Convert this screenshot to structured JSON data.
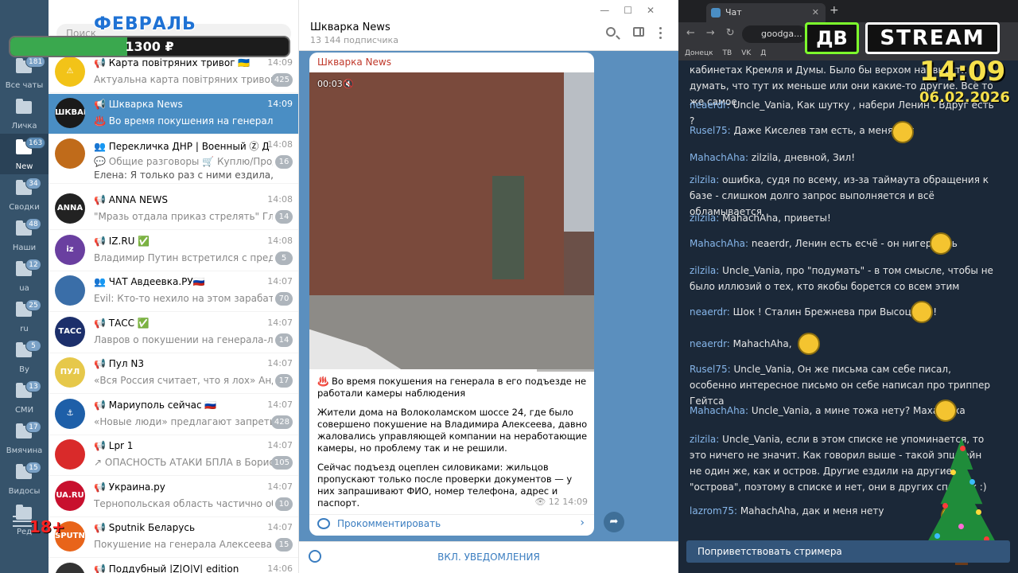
{
  "telegram": {
    "folders": [
      {
        "label": "Все чаты",
        "badge": "181",
        "active": false
      },
      {
        "label": "Личка",
        "badge": "",
        "active": false
      },
      {
        "label": "New",
        "badge": "163",
        "active": true
      },
      {
        "label": "Сводки",
        "badge": "34",
        "active": false
      },
      {
        "label": "Наши",
        "badge": "48",
        "active": false
      },
      {
        "label": "ua",
        "badge": "12",
        "active": false
      },
      {
        "label": "ru",
        "badge": "25",
        "active": false
      },
      {
        "label": "By",
        "badge": "5",
        "active": false
      },
      {
        "label": "СМИ",
        "badge": "13",
        "active": false
      },
      {
        "label": "Вмячина",
        "badge": "17",
        "active": false
      },
      {
        "label": "Видосы",
        "badge": "15",
        "active": false
      },
      {
        "label": "Ред",
        "badge": "",
        "active": false
      }
    ],
    "age_label": "18+",
    "search_placeholder": "Поиск",
    "chats": [
      {
        "name": "📢 Карта повітряних тривог 🇺🇦",
        "time": "14:09",
        "preview": "Актуальна карта повітряних тривог ...",
        "badge": "425",
        "avatar_color": "#f2c318",
        "avatar_text": "⚠",
        "active": false
      },
      {
        "name": "📢 Шкварка News",
        "time": "14:09",
        "preview": "♨️ Во время покушения на генерала в его...",
        "badge": "",
        "avatar_color": "#1a1a1a",
        "avatar_text": "ШКВАРКА",
        "active": true
      },
      {
        "name": "👥 Перекличка ДНР | Военный Ⓩ Дон...",
        "time": "14:08",
        "preview": "💬 Общие разговоры  🛒 Куплю/Прод...",
        "preview2": "Елена: Я только раз с ними ездила, на п...",
        "badge": "16",
        "avatar_color": "#c06b1a",
        "avatar_text": "",
        "active": false,
        "tall": true
      },
      {
        "name": "📢 ANNA NEWS",
        "time": "14:08",
        "preview": "\"Мразь отдала приказ стрелять\" Гл...",
        "badge": "14",
        "avatar_color": "#222222",
        "avatar_text": "ANNA",
        "active": false
      },
      {
        "name": "📢 IZ.RU ✅",
        "time": "14:08",
        "preview": "Владимир Путин встретился с председ...",
        "badge": "5",
        "avatar_color": "#6a3fa0",
        "avatar_text": "iz",
        "active": false
      },
      {
        "name": "👥 ЧАТ Авдеевка.РУ🇷🇺",
        "time": "14:07",
        "preview": "Evil: Кто-то нехило на этом зарабатывает...",
        "badge": "70",
        "avatar_color": "#3a6ea8",
        "avatar_text": "",
        "active": false
      },
      {
        "name": "📢 ТАСС ✅",
        "time": "14:07",
        "preview": "Лавров о покушении на генерала-л...",
        "badge": "14",
        "avatar_color": "#1c2f6b",
        "avatar_text": "ТАСС",
        "active": false
      },
      {
        "name": "📢 Пул N3",
        "time": "14:07",
        "preview": "«Вся Россия считает, что я лох»  Андр...",
        "badge": "17",
        "avatar_color": "#e6c84a",
        "avatar_text": "ПУЛ 03",
        "active": false
      },
      {
        "name": "📢 Мариуполь сейчас 🇷🇺",
        "time": "14:07",
        "preview": "«Новые люди» предлагают запретить...",
        "badge": "428",
        "avatar_color": "#1e5fa8",
        "avatar_text": "⚓",
        "active": false
      },
      {
        "name": "📢 Lpr 1",
        "time": "14:07",
        "preview": "↗ ОПАСНОСТЬ АТАКИ БПЛА в Борисовск...",
        "badge": "105",
        "avatar_color": "#d92a2a",
        "avatar_text": "",
        "active": false
      },
      {
        "name": "📢 Украина.ру",
        "time": "14:07",
        "preview": "Тернопольская область частично обе...",
        "badge": "10",
        "avatar_color": "#c8102e",
        "avatar_text": "UA.RU",
        "active": false
      },
      {
        "name": "📢 Sputnik Беларусь",
        "time": "14:07",
        "preview": "Покушение на генерала Алексеева демон...",
        "badge": "15",
        "avatar_color": "#e8641a",
        "avatar_text": "SPUTNIK",
        "active": false
      },
      {
        "name": "📢 Поддубный |Z|O|V| edition",
        "time": "14:06",
        "preview": "",
        "badge": "",
        "avatar_color": "#333333",
        "avatar_text": "",
        "active": false
      }
    ],
    "conversation": {
      "title": "Шкварка News",
      "subscribers": "13 144 подписчика",
      "post_author": "Шкварка News",
      "video_time": "00:03",
      "video_progress": 0.8,
      "paragraphs": [
        "♨️ Во время покушения на генерала в его подъезде не работали камеры наблюдения",
        "Жители дома на Волоколамском шоссе 24, где было совершено покушение на Владимира Алексеева, давно жаловались управляющей компании на неработающие камеры, но проблему так и не решили.",
        "Сейчас подъезд оцеплен силовиками: жильцов пропускают только после проверки документов — у них запрашивают ФИО, номер телефона, адрес и паспорт."
      ],
      "views": "👁 12",
      "post_time": "14:09",
      "comment_label": "Прокомментировать",
      "notify_label": "ВКЛ. УВЕДОМЛЕНИЯ"
    }
  },
  "overlay": {
    "month": "ФЕВРАЛЬ",
    "goal": "1300 ₽",
    "goal_progress": 0.42,
    "clock": "14:09",
    "date": "06.02.2026",
    "logo_left": "ДВ",
    "logo_right": "STREAM"
  },
  "browser": {
    "tab_title": "Чат",
    "url": "goodga...",
    "bookmarks": [
      "Донецк",
      "ТВ",
      "VK",
      "Д"
    ],
    "messages": [
      {
        "user": "",
        "text": "кабинетах Кремля и Думы. Было бы верхом наивности думать, что тут их меньше или они какие-то другие. Всё то же самое"
      },
      {
        "user": "neaerdr:",
        "text": "Uncle_Vania, Как шутку , набери Ленин . Вдруг есть ?"
      },
      {
        "user": "Rusel75:",
        "text": "Даже Киселев там есть, а меня нет"
      },
      {
        "user": "MahachAha:",
        "text": "zilzila, дневной, Зил!"
      },
      {
        "user": "zilzila:",
        "text": "ошибка, судя по всему, из-за таймаута обращения к базе - слишком долго запрос выполняется и всё обламывается"
      },
      {
        "user": "zilzila:",
        "text": "MahachAha, приветы!"
      },
      {
        "user": "MahachAha:",
        "text": "neaerdr, Ленин есть есчё - он нигер веть"
      },
      {
        "user": "zilzila:",
        "text": "Uncle_Vania, про \"подумать\" - в том смысле, чтобы не было иллюзий о тех, кто якобы борется со всем этим"
      },
      {
        "user": "neaerdr:",
        "text": "Шок ! Сталин Брежнева при Высоцком !"
      },
      {
        "user": "neaerdr:",
        "text": "MahachAha,"
      },
      {
        "user": "Rusel75:",
        "text": "Uncle_Vania, Он же письма сам себе писал, особенно интересное письмо он себе написал про триппер Гейтса"
      },
      {
        "user": "MahachAha:",
        "text": "Uncle_Vania, а мине тожа нету? Махач Аха"
      },
      {
        "user": "zilzila:",
        "text": "Uncle_Vania, если в этом списке не упоминается, то это ничего не значит. Как говорил выше - такой эпштейн не один же, как и остров. Другие ездили на другие \"острова\", поэтому в списке и нет, они в других списках :)"
      },
      {
        "user": "lazrom75:",
        "text": "MahachAha, дак и меня нету"
      }
    ],
    "greet_button": "Поприветствовать стримера"
  }
}
